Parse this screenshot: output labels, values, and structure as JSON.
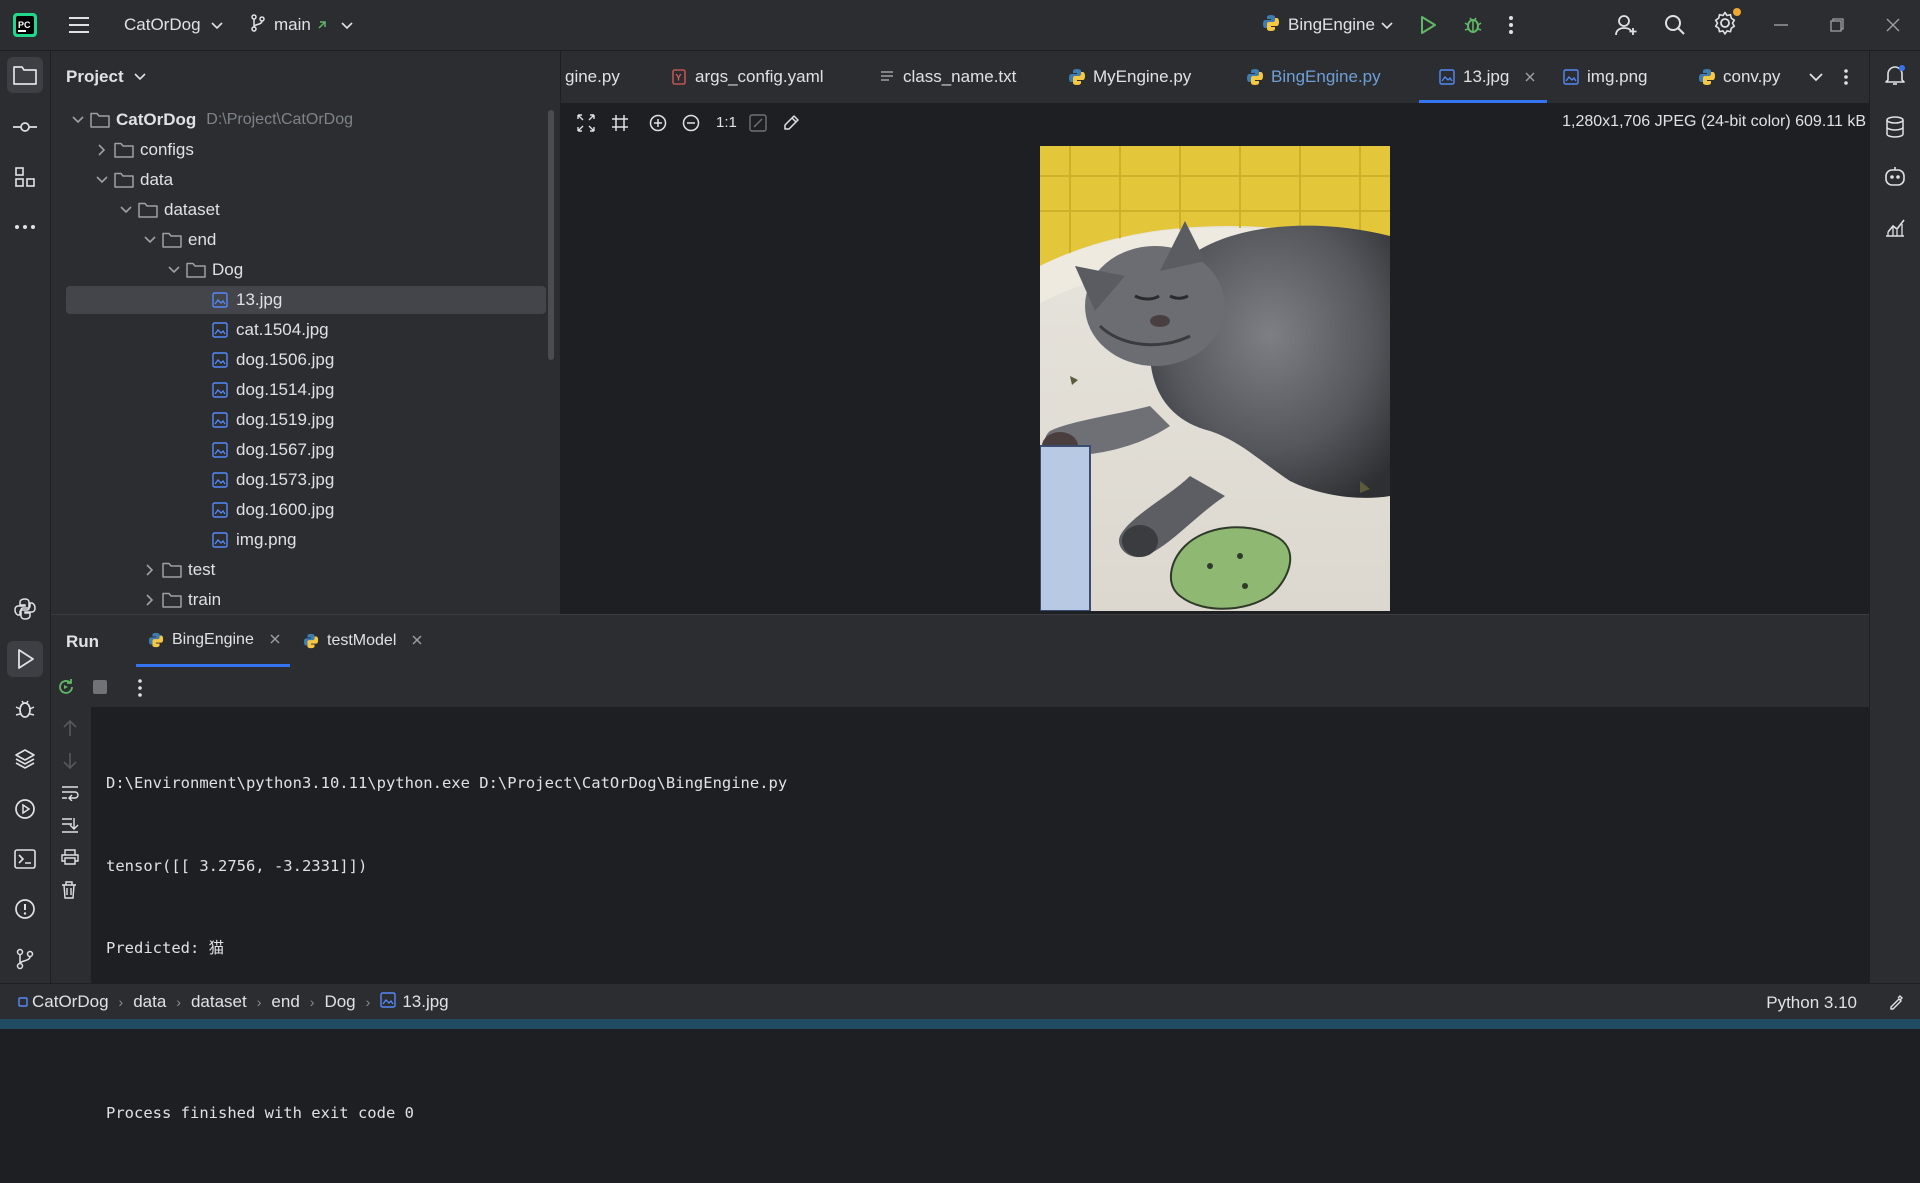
{
  "titlebar": {
    "project_name": "CatOrDog",
    "branch": "main",
    "run_config": "BingEngine"
  },
  "project_panel": {
    "title": "Project",
    "tree": [
      {
        "label": "CatOrDog",
        "hint": "D:\\Project\\CatOrDog"
      },
      {
        "label": "configs"
      },
      {
        "label": "data"
      },
      {
        "label": "dataset"
      },
      {
        "label": "end"
      },
      {
        "label": "Dog"
      },
      {
        "label": "13.jpg"
      },
      {
        "label": "cat.1504.jpg"
      },
      {
        "label": "dog.1506.jpg"
      },
      {
        "label": "dog.1514.jpg"
      },
      {
        "label": "dog.1519.jpg"
      },
      {
        "label": "dog.1567.jpg"
      },
      {
        "label": "dog.1573.jpg"
      },
      {
        "label": "dog.1600.jpg"
      },
      {
        "label": "img.png"
      },
      {
        "label": "test"
      },
      {
        "label": "train"
      }
    ]
  },
  "editor": {
    "tabs": [
      {
        "label": "gine.py"
      },
      {
        "label": "args_config.yaml"
      },
      {
        "label": "class_name.txt"
      },
      {
        "label": "MyEngine.py"
      },
      {
        "label": "BingEngine.py"
      },
      {
        "label": "13.jpg"
      },
      {
        "label": "img.png"
      },
      {
        "label": "conv.py"
      }
    ],
    "active_tab": "13.jpg",
    "zoom_label": "1:1",
    "image_info": "1,280x1,706 JPEG (24-bit color) 609.11 kB"
  },
  "run_panel": {
    "title": "Run",
    "tabs": [
      {
        "label": "BingEngine"
      },
      {
        "label": "testModel"
      }
    ],
    "console": [
      "D:\\Environment\\python3.10.11\\python.exe D:\\Project\\CatOrDog\\BingEngine.py",
      "tensor([[ 3.2756, -3.2331]])",
      "Predicted: 猫",
      "",
      "Process finished with exit code 0"
    ]
  },
  "statusbar": {
    "breadcrumbs": [
      "CatOrDog",
      "data",
      "dataset",
      "end",
      "Dog",
      "13.jpg"
    ],
    "interpreter": "Python 3.10"
  },
  "colors": {
    "accent": "#3574f0",
    "background": "#1e1f22",
    "panel": "#2b2d30",
    "active_tab_text": "#dfe1e5",
    "modified_tab_text": "#6f9fd8"
  }
}
